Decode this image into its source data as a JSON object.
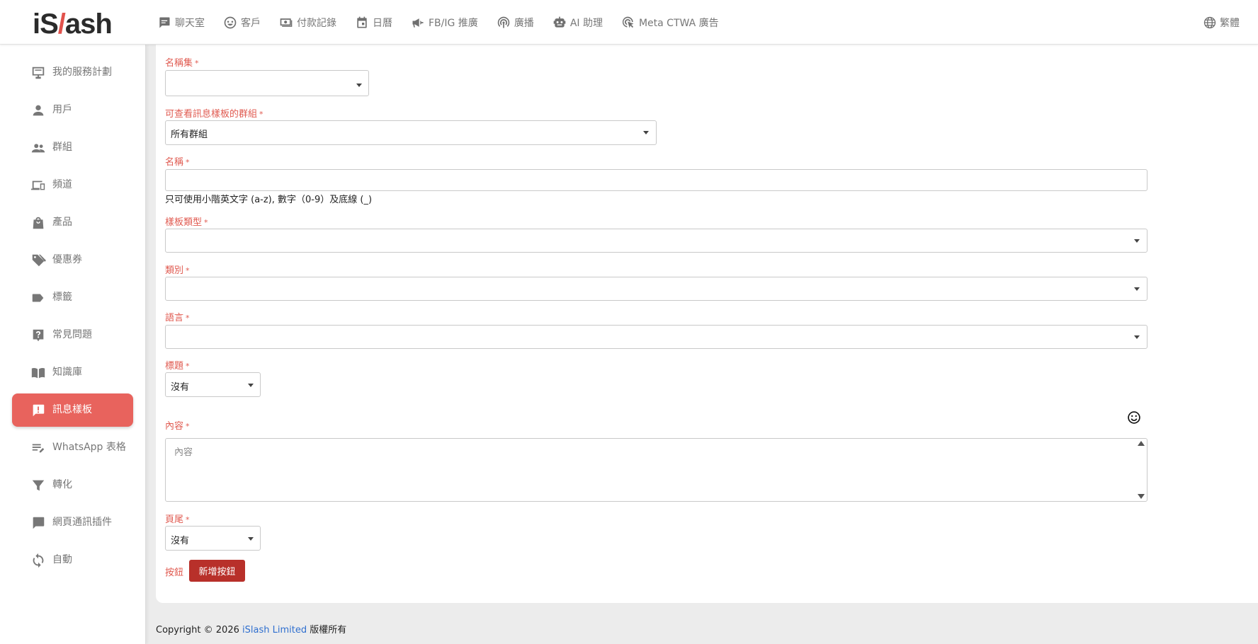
{
  "brand": {
    "logo_pre": "iS",
    "logo_slash": "/",
    "logo_post": "ash"
  },
  "topnav": {
    "items": [
      {
        "label": "聊天室",
        "icon": "chat-icon"
      },
      {
        "label": "客戶",
        "icon": "smiley-icon"
      },
      {
        "label": "付款記錄",
        "icon": "payment-icon"
      },
      {
        "label": "日曆",
        "icon": "calendar-icon"
      },
      {
        "label": "FB/IG 推廣",
        "icon": "megaphone-icon"
      },
      {
        "label": "廣播",
        "icon": "broadcast-icon"
      },
      {
        "label": "AI 助理",
        "icon": "robot-icon"
      },
      {
        "label": "Meta CTWA 廣告",
        "icon": "cursor-click-icon"
      }
    ],
    "language": "繁體"
  },
  "sidebar": {
    "items": [
      {
        "label": "我的服務計劃",
        "icon": "plan-icon"
      },
      {
        "label": "用戶",
        "icon": "user-icon"
      },
      {
        "label": "群組",
        "icon": "group-icon"
      },
      {
        "label": "頻道",
        "icon": "devices-icon"
      },
      {
        "label": "產品",
        "icon": "shopping-bag-icon"
      },
      {
        "label": "優惠券",
        "icon": "tags-icon"
      },
      {
        "label": "標籤",
        "icon": "label-icon"
      },
      {
        "label": "常見問題",
        "icon": "question-icon"
      },
      {
        "label": "知識庫",
        "icon": "book-icon"
      },
      {
        "label": "訊息樣板",
        "icon": "message-alert-icon",
        "active": true
      },
      {
        "label": "WhatsApp 表格",
        "icon": "form-list-icon"
      },
      {
        "label": "轉化",
        "icon": "funnel-icon"
      },
      {
        "label": "網頁通訊插件",
        "icon": "widget-chat-icon"
      },
      {
        "label": "自動",
        "icon": "sync-icon"
      }
    ]
  },
  "form": {
    "namespace": {
      "label": "名稱集",
      "value": ""
    },
    "visible_group": {
      "label": "可查看訊息樣板的群組",
      "value": "所有群組"
    },
    "name": {
      "label": "名稱",
      "value": "",
      "helper": "只可使用小階英文字 (a-z), 數字（0-9）及底線 (_)"
    },
    "template_type": {
      "label": "樣板類型",
      "value": ""
    },
    "category": {
      "label": "類別",
      "value": ""
    },
    "language": {
      "label": "語言",
      "value": ""
    },
    "header": {
      "label": "標題",
      "value": "沒有"
    },
    "content": {
      "label": "內容",
      "placeholder": "內容",
      "value": ""
    },
    "footer": {
      "label": "頁尾",
      "value": "沒有"
    },
    "buttons": {
      "label": "按鈕",
      "add_label": "新增按鈕"
    },
    "required_mark": "*"
  },
  "footer": {
    "copyright": "Copyright © 2026",
    "company": "iSlash Limited",
    "rights": "版權所有"
  },
  "colors": {
    "accent": "#e8635d",
    "label": "#e05a50",
    "button": "#b8302a",
    "link": "#2f6fcf"
  }
}
